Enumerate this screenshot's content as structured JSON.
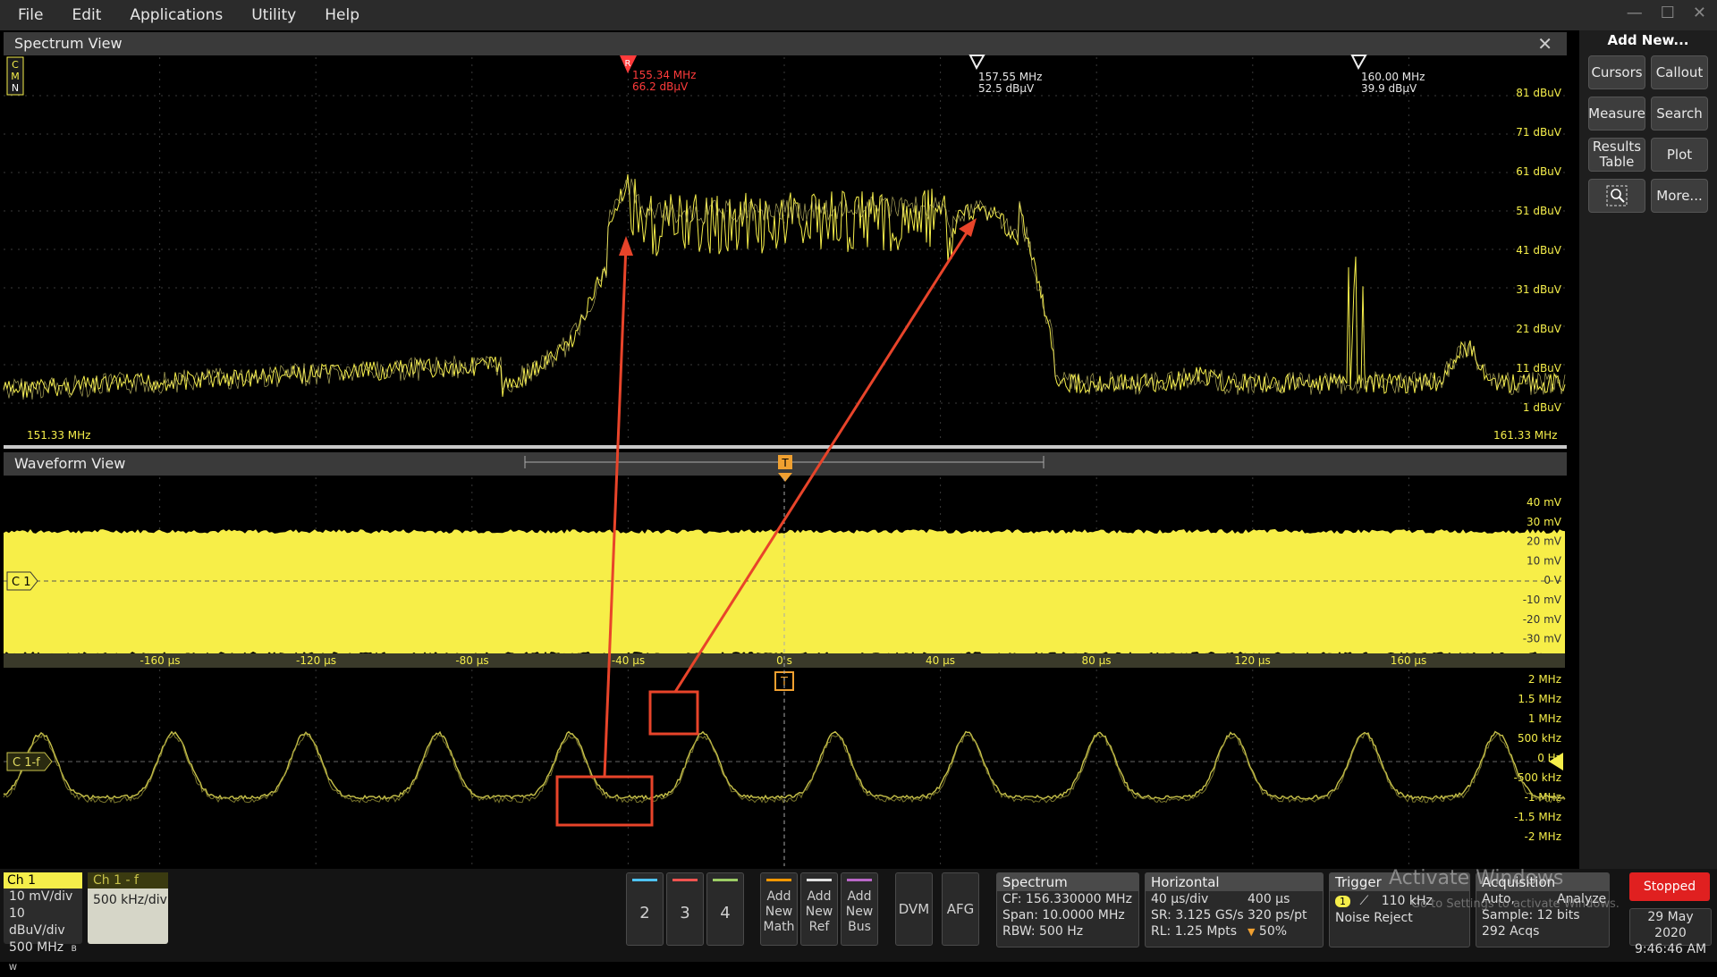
{
  "menu": [
    "File",
    "Edit",
    "Applications",
    "Utility",
    "Help"
  ],
  "window_controls": {
    "minimize": "—",
    "maximize": "☐",
    "close": "✕"
  },
  "spectrum": {
    "title": "Spectrum View",
    "mode_letters": [
      "C",
      "M",
      "N"
    ],
    "markers": [
      {
        "label": "R",
        "freq": "155.34 MHz",
        "level": "66.2 dBμV",
        "color": "#ff3b3b"
      },
      {
        "label": "",
        "freq": "157.55 MHz",
        "level": "52.5 dBμV",
        "color": "#e6e6e6"
      },
      {
        "label": "",
        "freq": "160.00 MHz",
        "level": "39.9 dBμV",
        "color": "#e6e6e6"
      }
    ],
    "y_ticks": [
      "81 dBuV",
      "71 dBuV",
      "61 dBuV",
      "51 dBuV",
      "41 dBuV",
      "31 dBuV",
      "21 dBuV",
      "11 dBuV",
      "1 dBuV"
    ],
    "x_start": "151.33 MHz",
    "x_stop": "161.33 MHz"
  },
  "waveform": {
    "title": "Waveform View",
    "trigger_marker": "T",
    "ch1_label": "C 1",
    "math_label": "C 1-f",
    "ch1_ticks": [
      "40 mV",
      "30 mV",
      "20 mV",
      "10 mV",
      "0 V",
      "-10 mV",
      "-20 mV",
      "-30 mV",
      "-40 mV"
    ],
    "time_ticks": [
      "-160 μs",
      "-120 μs",
      "-80 μs",
      "-40 μs",
      "0 s",
      "40 μs",
      "80 μs",
      "120 μs",
      "160 μs"
    ],
    "math_ticks": [
      "2 MHz",
      "1.5 MHz",
      "1 MHz",
      "500 kHz",
      "0 Hz",
      "-500 kHz",
      "-1 MHz",
      "-1.5 MHz",
      "-2 MHz"
    ]
  },
  "side_panel": {
    "title": "Add New...",
    "buttons": [
      "Cursors",
      "Callout",
      "Measure",
      "Search",
      "Results Table",
      "Plot",
      "",
      "More..."
    ]
  },
  "bottom": {
    "ch1": {
      "title": "Ch 1",
      "lines": [
        "10 mV/div",
        "10 dBuV/div",
        "500 MHz"
      ],
      "bw_mark": "B W"
    },
    "ch1f": {
      "title": "Ch 1 - f",
      "lines": [
        "500 kHz/div"
      ]
    },
    "channels": [
      {
        "label": "2",
        "color": "#4fc3f7"
      },
      {
        "label": "3",
        "color": "#ef5350"
      },
      {
        "label": "4",
        "color": "#9ccc65"
      }
    ],
    "add_buttons": [
      {
        "lines": [
          "Add",
          "New",
          "Math"
        ],
        "color": "#ff9800"
      },
      {
        "lines": [
          "Add",
          "New",
          "Ref"
        ],
        "color": "#e0e0e0"
      },
      {
        "lines": [
          "Add",
          "New",
          "Bus"
        ],
        "color": "#ba68c8"
      }
    ],
    "dvm": "DVM",
    "afg": "AFG",
    "spectrum_badge": {
      "title": "Spectrum",
      "lines": [
        "CF: 156.330000 MHz",
        "Span: 10.0000 MHz",
        "RBW: 500 Hz"
      ]
    },
    "horizontal": {
      "title": "Horizontal",
      "l1a": "40 μs/div",
      "l1b": "400 μs",
      "l2a": "SR: 3.125 GS/s",
      "l2b": "320 ps/pt",
      "l3a": "RL: 1.25 Mpts",
      "l3b": "50%"
    },
    "trigger": {
      "title": "Trigger",
      "source": "1",
      "freq": "110 kHz",
      "line2": "Noise Reject"
    },
    "acquisition": {
      "title": "Acquisition",
      "l1a": "Auto,",
      "l1b": "Analyze",
      "l2": "Sample: 12 bits",
      "l3": "292 Acqs"
    },
    "stopped": "Stopped",
    "date": "29 May 2020",
    "time": "9:46:46 AM",
    "watermark1": "Activate Windows",
    "watermark2": "Go to Settings to activate Windows."
  },
  "colors": {
    "trace": "#f5ee4a",
    "annotation": "#e8442a",
    "marker_ref": "#ff3b3b"
  }
}
